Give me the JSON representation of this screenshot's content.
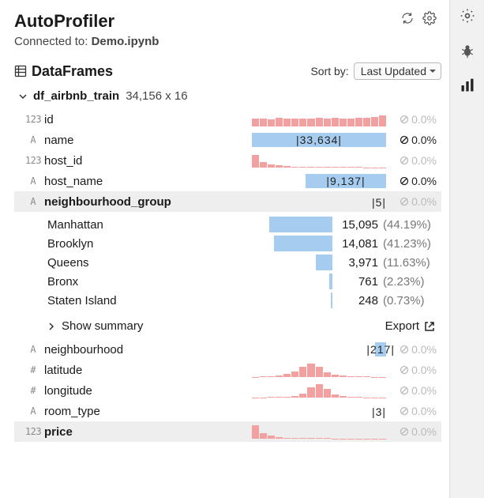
{
  "header": {
    "title": "AutoProfiler",
    "connected_prefix": "Connected to: ",
    "connected_file": "Demo.ipynb"
  },
  "section": {
    "title": "DataFrames",
    "sort_label": "Sort by:",
    "sort_value": "Last Updated"
  },
  "dataframe": {
    "name": "df_airbnb_train",
    "shape": "34,156 x 16"
  },
  "columns": [
    {
      "type": "123",
      "name": "id",
      "bold": false,
      "viz": "bars",
      "bars": [
        55,
        58,
        52,
        60,
        56,
        54,
        58,
        55,
        62,
        57,
        60,
        55,
        58,
        63,
        60,
        66,
        80
      ],
      "null": "0.0%",
      "null_dark": false,
      "sel": false
    },
    {
      "type": "A",
      "name": "name",
      "bold": false,
      "viz": "blue",
      "blue_w": 100,
      "card": "|33,634|",
      "null": "0.0%",
      "null_dark": true,
      "sel": false
    },
    {
      "type": "123",
      "name": "host_id",
      "bold": false,
      "viz": "bars",
      "bars": [
        90,
        40,
        22,
        14,
        10,
        8,
        6,
        5,
        4,
        4,
        3,
        3,
        3,
        3,
        2,
        2,
        2
      ],
      "null": "0.0%",
      "null_dark": false,
      "sel": false
    },
    {
      "type": "A",
      "name": "host_name",
      "bold": false,
      "viz": "blue",
      "blue_w": 60,
      "card": "|9,137|",
      "null": "0.0%",
      "null_dark": true,
      "sel": false
    },
    {
      "type": "A",
      "name": "neighbourhood_group",
      "bold": true,
      "viz": "card",
      "card": "|5|",
      "null": "0.0%",
      "null_dark": false,
      "sel": true
    }
  ],
  "values": [
    {
      "label": "Manhattan",
      "count": "15,095",
      "pct": "(44.19%)",
      "bar": 80
    },
    {
      "label": "Brooklyn",
      "count": "14,081",
      "pct": "(41.23%)",
      "bar": 74
    },
    {
      "label": "Queens",
      "count": "3,971",
      "pct": "(11.63%)",
      "bar": 21
    },
    {
      "label": "Bronx",
      "count": "761",
      "pct": "(2.23%)",
      "bar": 4
    },
    {
      "label": "Staten Island",
      "count": "248",
      "pct": "(0.73%)",
      "bar": 2
    }
  ],
  "summary": {
    "show": "Show summary",
    "export": "Export"
  },
  "columns2": [
    {
      "type": "A",
      "name": "neighbourhood",
      "bold": false,
      "viz": "blue",
      "blue_w": 8,
      "card": "|217|",
      "null": "0.0%",
      "null_dark": false,
      "sel": false
    },
    {
      "type": "#",
      "name": "latitude",
      "bold": false,
      "viz": "bars",
      "bars": [
        2,
        3,
        5,
        10,
        20,
        40,
        70,
        95,
        70,
        35,
        18,
        10,
        6,
        4,
        3,
        2,
        2
      ],
      "null": "0.0%",
      "null_dark": false,
      "sel": false
    },
    {
      "type": "#",
      "name": "longitude",
      "bold": false,
      "viz": "bars",
      "bars": [
        2,
        2,
        3,
        4,
        6,
        12,
        30,
        70,
        95,
        60,
        25,
        10,
        5,
        3,
        2,
        2,
        2
      ],
      "null": "0.0%",
      "null_dark": false,
      "sel": false
    },
    {
      "type": "A",
      "name": "room_type",
      "bold": false,
      "viz": "card",
      "card": "|3|",
      "null": "0.0%",
      "null_dark": false,
      "sel": false
    },
    {
      "type": "123",
      "name": "price",
      "bold": true,
      "viz": "bars",
      "bars": [
        95,
        40,
        20,
        12,
        8,
        6,
        5,
        4,
        3,
        3,
        2,
        2,
        2,
        2,
        2,
        2,
        2
      ],
      "null": "0.0%",
      "null_dark": false,
      "sel": true
    }
  ]
}
